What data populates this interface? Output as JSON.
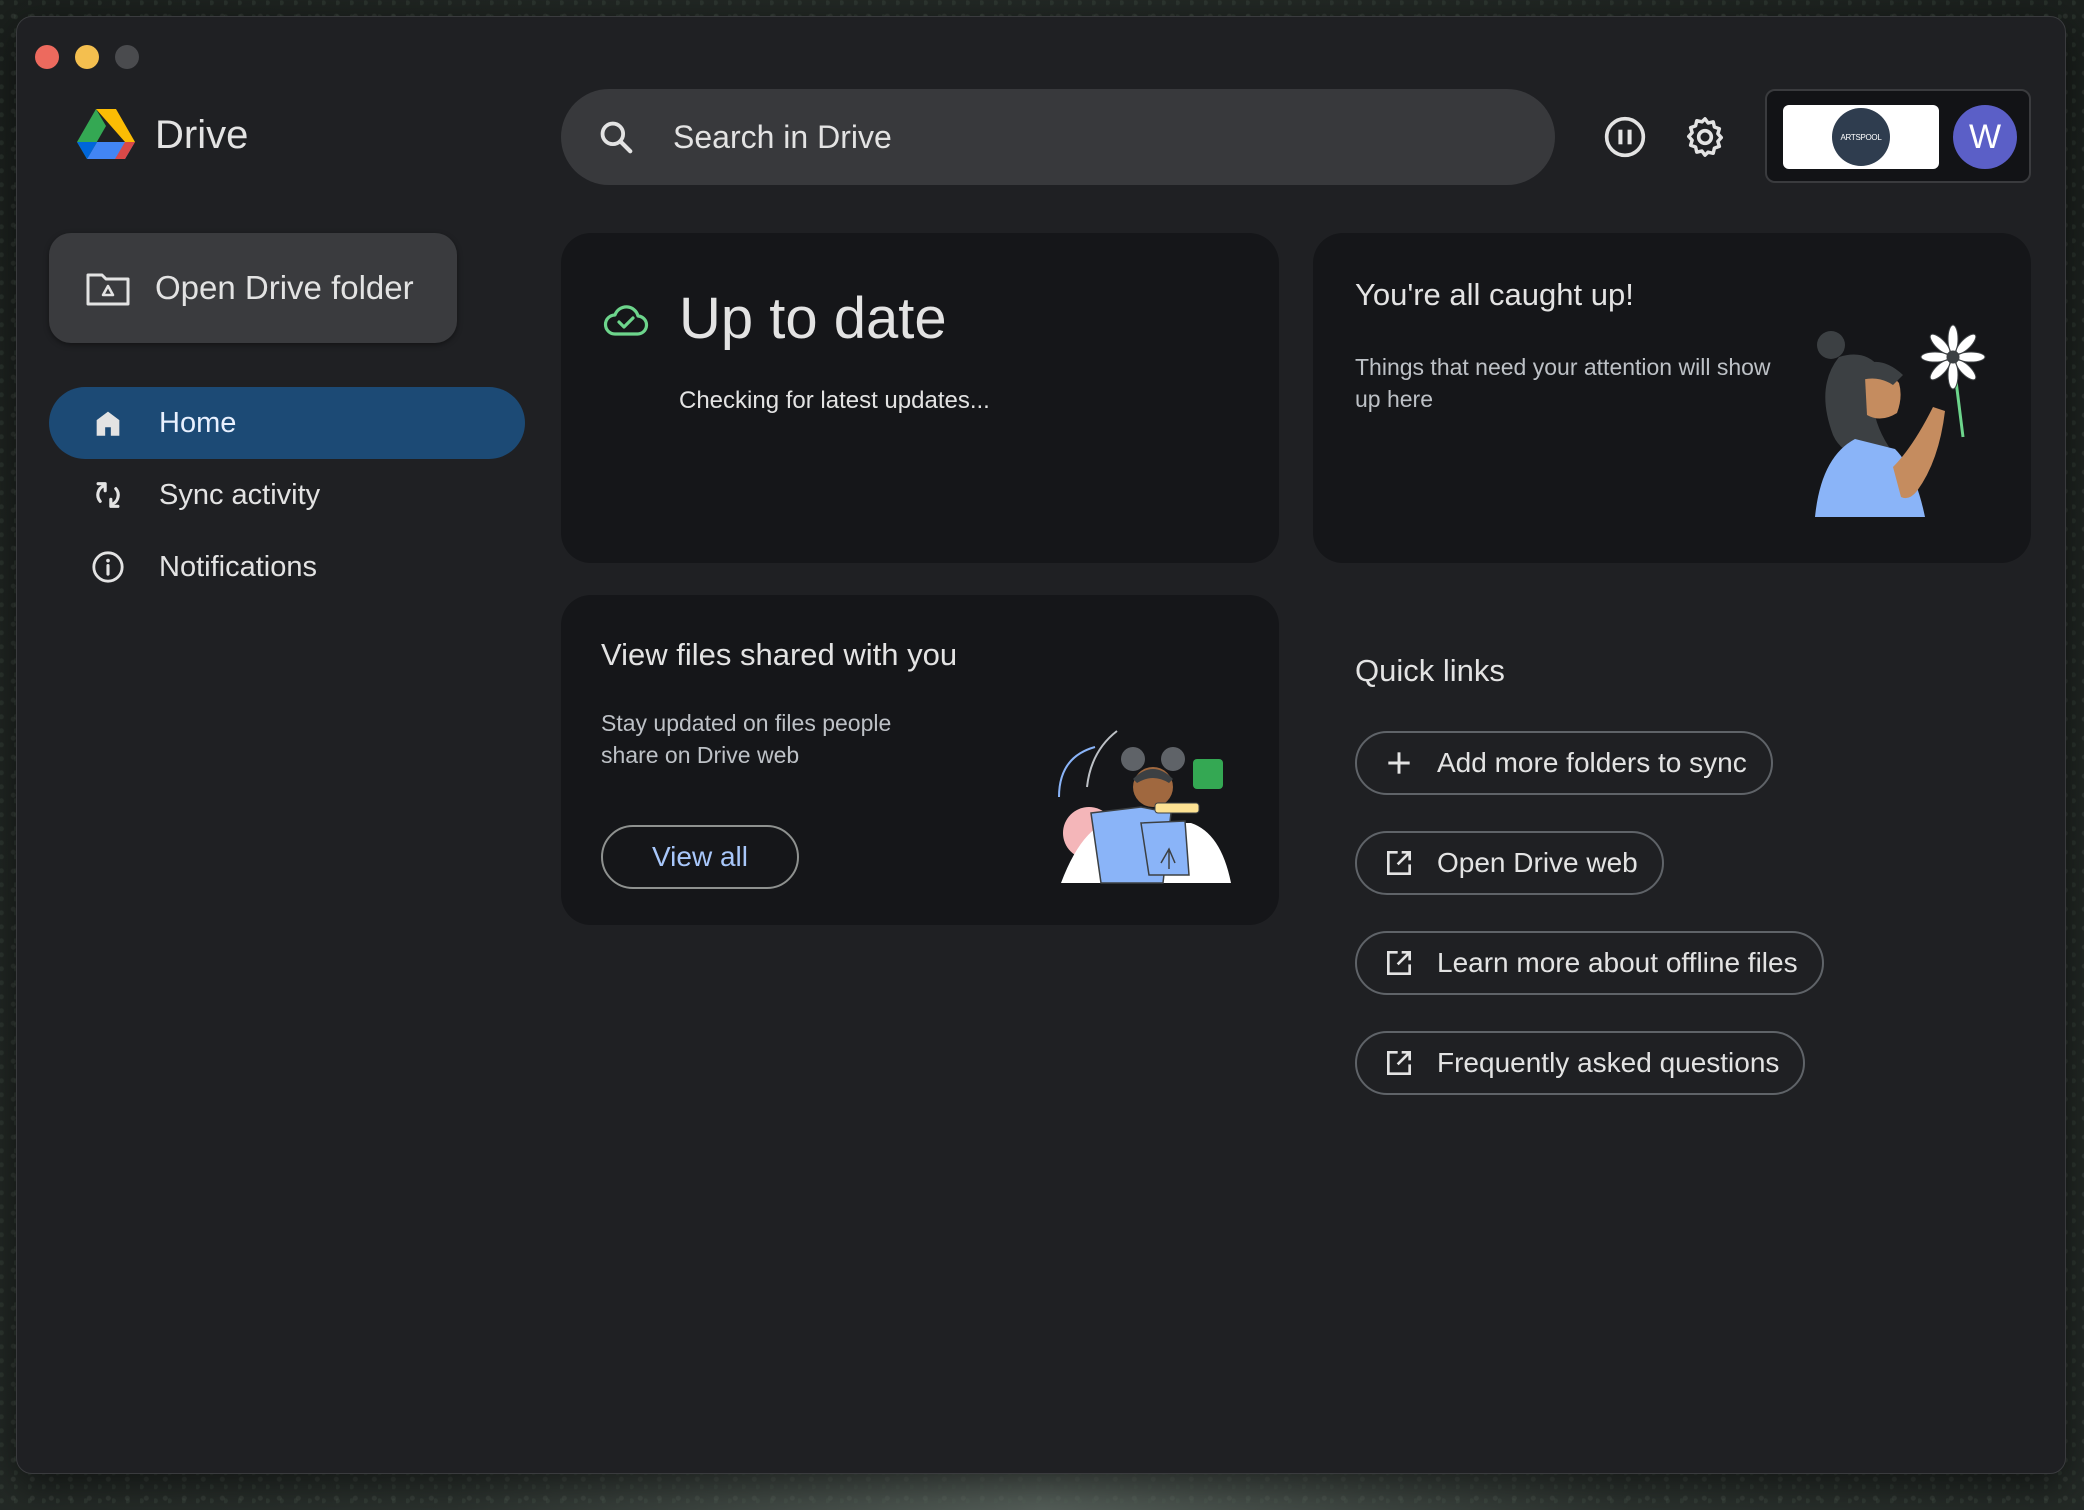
{
  "app": {
    "name": "Drive"
  },
  "search": {
    "placeholder": "Search in Drive"
  },
  "account": {
    "org_logo_text": "ARTSPOOL",
    "avatar_letter": "W",
    "avatar_color": "#5b5fc7"
  },
  "sidebar": {
    "open_folder_label": "Open Drive folder",
    "items": [
      {
        "label": "Home",
        "icon": "home-icon",
        "active": true
      },
      {
        "label": "Sync activity",
        "icon": "sync-icon",
        "active": false
      },
      {
        "label": "Notifications",
        "icon": "info-icon",
        "active": false
      }
    ]
  },
  "status_card": {
    "title": "Up to date",
    "subtitle": "Checking for latest updates...",
    "icon": "cloud-check-icon"
  },
  "caught_up_card": {
    "title": "You're all caught up!",
    "body": "Things that need your attention will show up here"
  },
  "shared_card": {
    "title": "View files shared with you",
    "body": "Stay updated on files people share on Drive web",
    "button": "View all"
  },
  "quick_links": {
    "title": "Quick links",
    "items": [
      {
        "label": "Add more folders to sync",
        "icon": "plus-icon"
      },
      {
        "label": "Open Drive web",
        "icon": "open-external-icon"
      },
      {
        "label": "Learn more about offline files",
        "icon": "open-external-icon"
      },
      {
        "label": "Frequently asked questions",
        "icon": "open-external-icon"
      }
    ]
  },
  "colors": {
    "accent_active_nav": "#1c4a75",
    "link_blue": "#a8c7fa",
    "status_green": "#6dd58c"
  }
}
